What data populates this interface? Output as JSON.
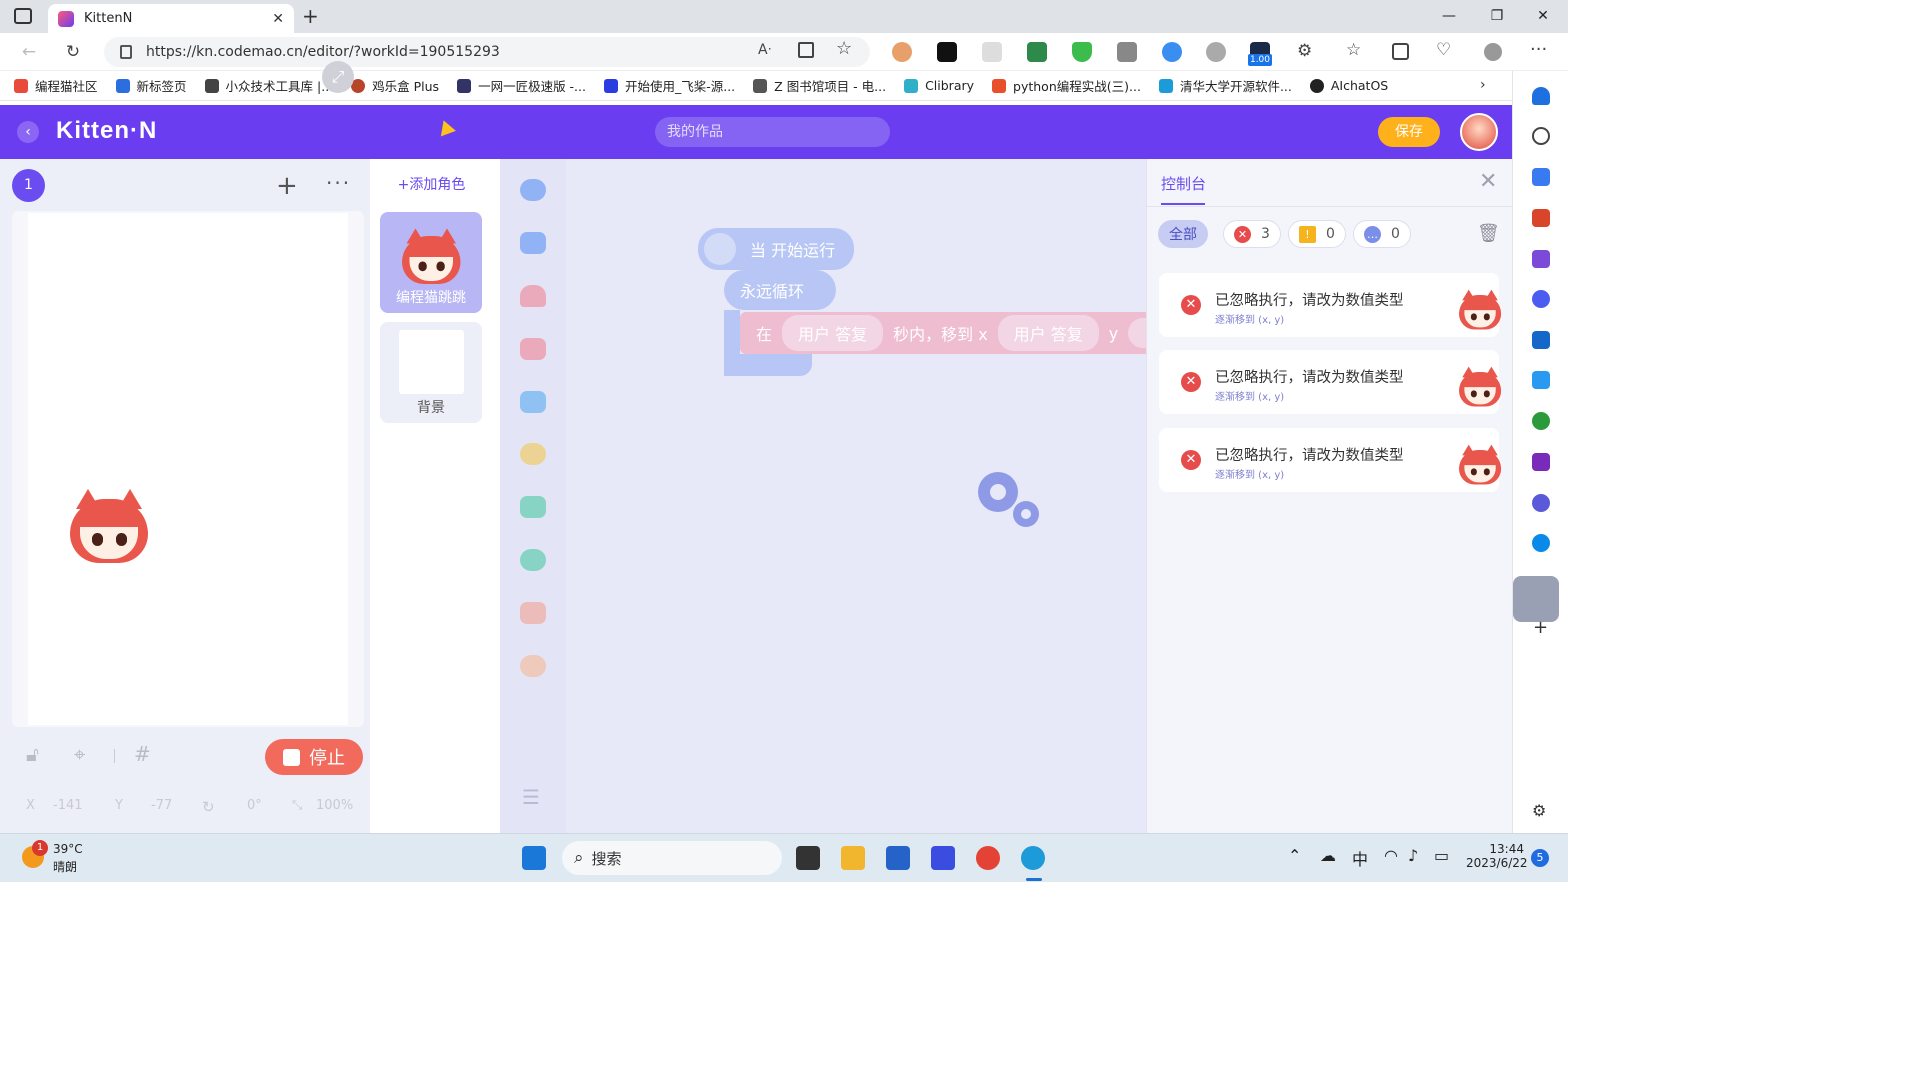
{
  "browser": {
    "tab_title": "KittenN",
    "url": "https://kn.codemao.cn/editor/?workId=190515293",
    "badge_version": "1.00"
  },
  "bookmarks": [
    {
      "label": "编程猫社区",
      "color": "#e84b3c"
    },
    {
      "label": "新标签页",
      "color": "#2a6ee0"
    },
    {
      "label": "小众技术工具库 |...",
      "color": "#444444"
    },
    {
      "label": "鸡乐盒 Plus",
      "color": "#b8442a"
    },
    {
      "label": "一网一匠极速版 -...",
      "color": "#333366"
    },
    {
      "label": "开始使用_飞桨-源...",
      "color": "#2b3de0"
    },
    {
      "label": "Z 图书馆项目 - 电...",
      "color": "#555555"
    },
    {
      "label": "Clibrary",
      "color": "#2fb0c8"
    },
    {
      "label": "python编程实战(三)...",
      "color": "#e8502c"
    },
    {
      "label": "清华大学开源软件...",
      "color": "#1b9bd8"
    },
    {
      "label": "AIchatOS",
      "color": "#222222"
    }
  ],
  "app": {
    "logo": "Kitten·N",
    "work_name_placeholder": "我的作品",
    "save_label": "保存",
    "accent": "#6a3df0"
  },
  "stage_panel": {
    "scene_number": "1",
    "stop_label": "停止",
    "coords": {
      "x_label": "X",
      "x_value": "-141",
      "y_label": "Y",
      "y_value": "-77",
      "rotation": "0°",
      "scale": "100%"
    }
  },
  "sprites": {
    "add_label": "+添加角色",
    "items": [
      {
        "label": "编程猫跳跳"
      },
      {
        "label": "背景"
      }
    ]
  },
  "palette": {
    "colors": [
      "#4e8bf5",
      "#4e8bf5",
      "#f07a8a",
      "#f07a8a",
      "#4ba6f0",
      "#f5c542",
      "#3ec79a",
      "#3ec79a",
      "#f49a8a",
      "#f5b48a"
    ]
  },
  "workspace": {
    "blocks": {
      "start": "当 开始运行",
      "forever": "永远循环",
      "move_prefix": "在",
      "arg1": "用户 答复",
      "move_mid": "秒内，移到 x",
      "arg2": "用户 答复",
      "move_y": "y"
    }
  },
  "console": {
    "tab_label": "控制台",
    "filters": {
      "all": "全部",
      "errors": "3",
      "warnings": "0",
      "messages": "0"
    },
    "entries": [
      {
        "message": "已忽略执行，请改为数值类型",
        "detail": "逐渐移到 (x, y)"
      },
      {
        "message": "已忽略执行，请改为数值类型",
        "detail": "逐渐移到 (x, y)"
      },
      {
        "message": "已忽略执行，请改为数值类型",
        "detail": "逐渐移到 (x, y)"
      }
    ]
  },
  "taskbar": {
    "weather_badge": "1",
    "temperature": "39°C",
    "weather_desc": "晴朗",
    "search_label": "搜索",
    "ime": "中",
    "time": "13:44",
    "date": "2023/6/22",
    "notifications": "5"
  }
}
